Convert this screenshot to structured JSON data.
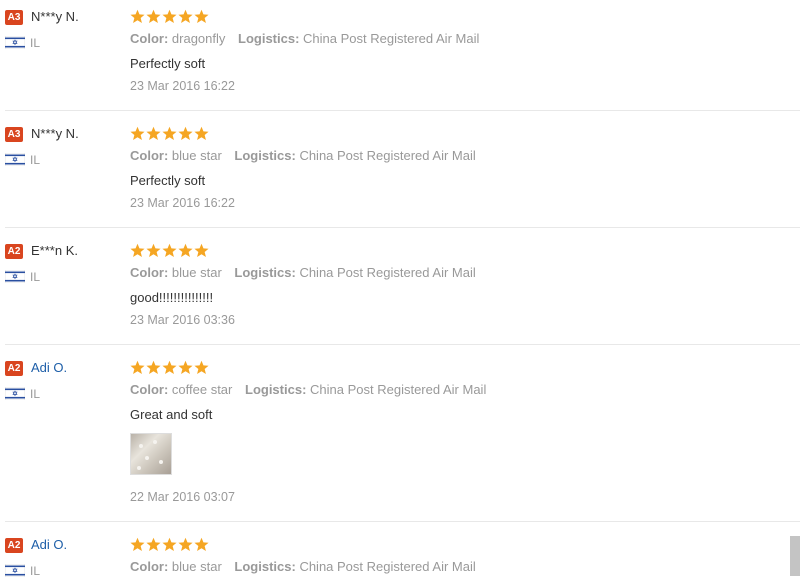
{
  "labels": {
    "color": "Color:",
    "logistics": "Logistics:"
  },
  "star_color": "#f5a623",
  "reviews": [
    {
      "badge": "A3",
      "buyer": "N***y N.",
      "country": "IL",
      "rating": 5,
      "color": "dragonfly",
      "logistics": "China Post Registered Air Mail",
      "text": "Perfectly soft",
      "date": "23 Mar 2016 16:22"
    },
    {
      "badge": "A3",
      "buyer": "N***y N.",
      "country": "IL",
      "rating": 5,
      "color": "blue star",
      "logistics": "China Post Registered Air Mail",
      "text": "Perfectly soft",
      "date": "23 Mar 2016 16:22"
    },
    {
      "badge": "A2",
      "buyer": "E***n K.",
      "country": "IL",
      "rating": 5,
      "color": "blue star",
      "logistics": "China Post Registered Air Mail",
      "text": "good!!!!!!!!!!!!!!!",
      "date": "23 Mar 2016 03:36"
    },
    {
      "badge": "A2",
      "buyer": "Adi O.",
      "country": "IL",
      "rating": 5,
      "color": "coffee star",
      "logistics": "China Post Registered Air Mail",
      "text": "Great and soft",
      "date": "22 Mar 2016 03:07"
    },
    {
      "badge": "A2",
      "buyer": "Adi O.",
      "country": "IL",
      "rating": 5,
      "color": "blue star",
      "logistics": "China Post Registered Air Mail"
    }
  ]
}
